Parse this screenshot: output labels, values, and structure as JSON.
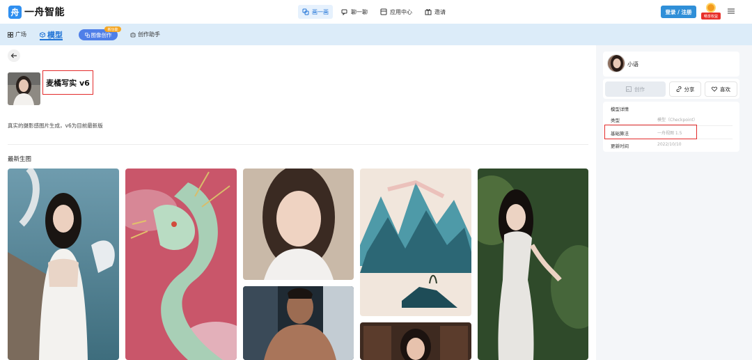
{
  "header": {
    "logo_glyph": "舟",
    "logo_text": "一舟智能",
    "nav": [
      {
        "label": "画一画",
        "icon": "palette-icon",
        "active": true
      },
      {
        "label": "聊一聊",
        "icon": "chat-icon",
        "active": false
      },
      {
        "label": "应用中心",
        "icon": "apps-icon",
        "active": false
      },
      {
        "label": "邀请",
        "icon": "gift-icon",
        "active": false
      }
    ],
    "login_label": "登录 / 注册",
    "promo_label": "畅享权益"
  },
  "subnav": {
    "plaza_label": "广场",
    "model_label": "模型",
    "image_create_label": "图像创作",
    "new_badge": "新功能",
    "assistant_label": "创作助手"
  },
  "model": {
    "name": "麦橘写实 v6",
    "description": "真实的摄影感图片生成，v6为目前最新版"
  },
  "gallery": {
    "title": "最新生图"
  },
  "author": {
    "name": "小语"
  },
  "actions": {
    "create": "创作",
    "share": "分享",
    "like": "喜欢"
  },
  "details": {
    "title": "模型详情",
    "rows": [
      {
        "label": "类型",
        "value": "模型（Checkpoint）"
      },
      {
        "label": "基础算法",
        "value": "一舟视图 1.5"
      },
      {
        "label": "更新时间",
        "value": "2022/10/10"
      }
    ]
  },
  "colors": {
    "accent": "#1f73d6",
    "subnav_bg": "#dcecf9",
    "highlight": "#e32a2a"
  }
}
